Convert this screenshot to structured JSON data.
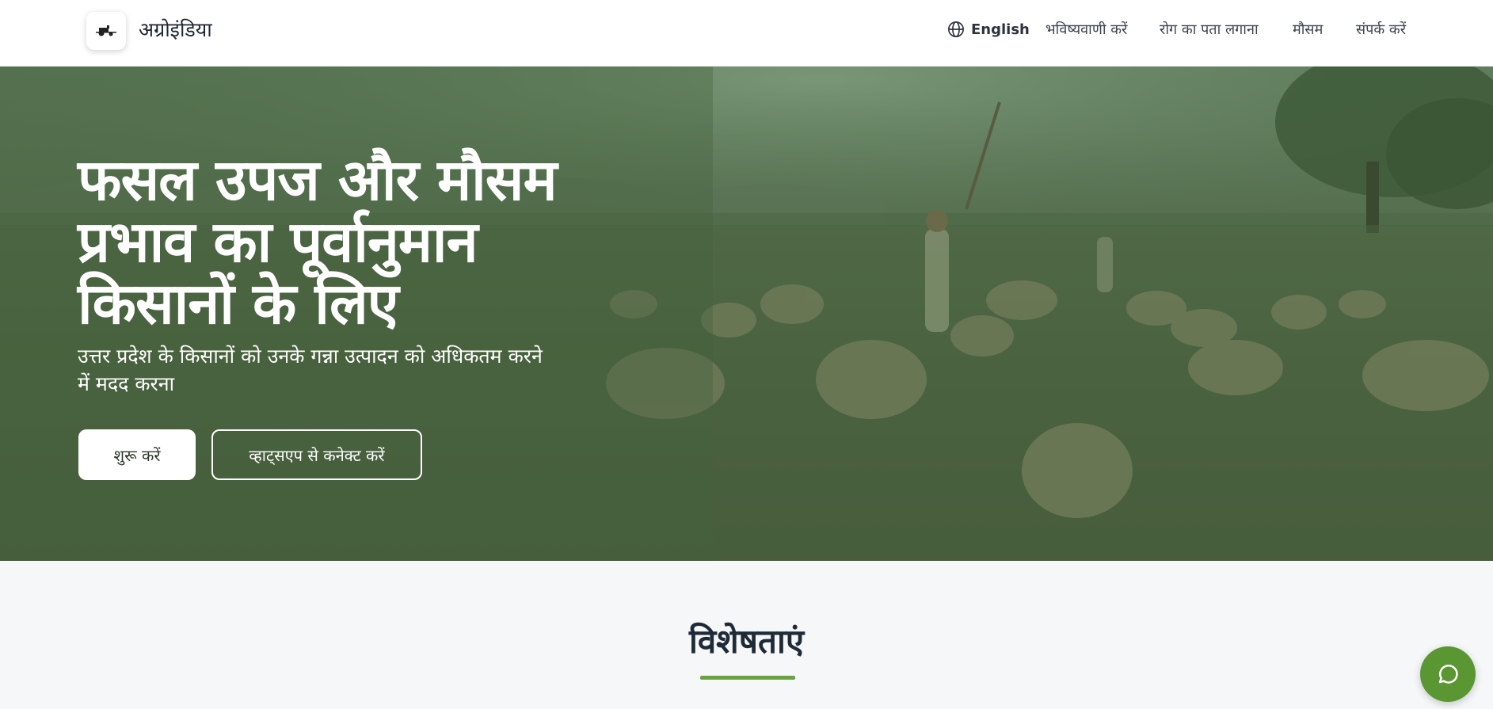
{
  "header": {
    "brand": "अग्रोइंडिया",
    "language": "English",
    "nav": [
      "भविष्यवाणी करें",
      "रोग का पता लगाना",
      "मौसम",
      "संपर्क करें"
    ]
  },
  "hero": {
    "title_lines": [
      "फसल उपज और मौसम",
      "प्रभाव का पूर्वानुमान",
      "किसानों के लिए"
    ],
    "subtitle_lines": [
      "उत्तर प्रदेश के किसानों को उनके गन्ना उत्पादन को अधिकतम करने",
      "में मदद करना"
    ],
    "primary_button": "शुरू करें",
    "secondary_button": "व्हाट्सएप से कनेक्ट करें"
  },
  "features": {
    "title": "विशेषताएं"
  },
  "colors": {
    "accent": "#6aa33b",
    "fab": "#5a9632",
    "hero_overlay": "#4d6543"
  },
  "icons": {
    "language": "globe-icon",
    "logo": "tractor-icon",
    "chat": "chat-bubble-icon"
  }
}
